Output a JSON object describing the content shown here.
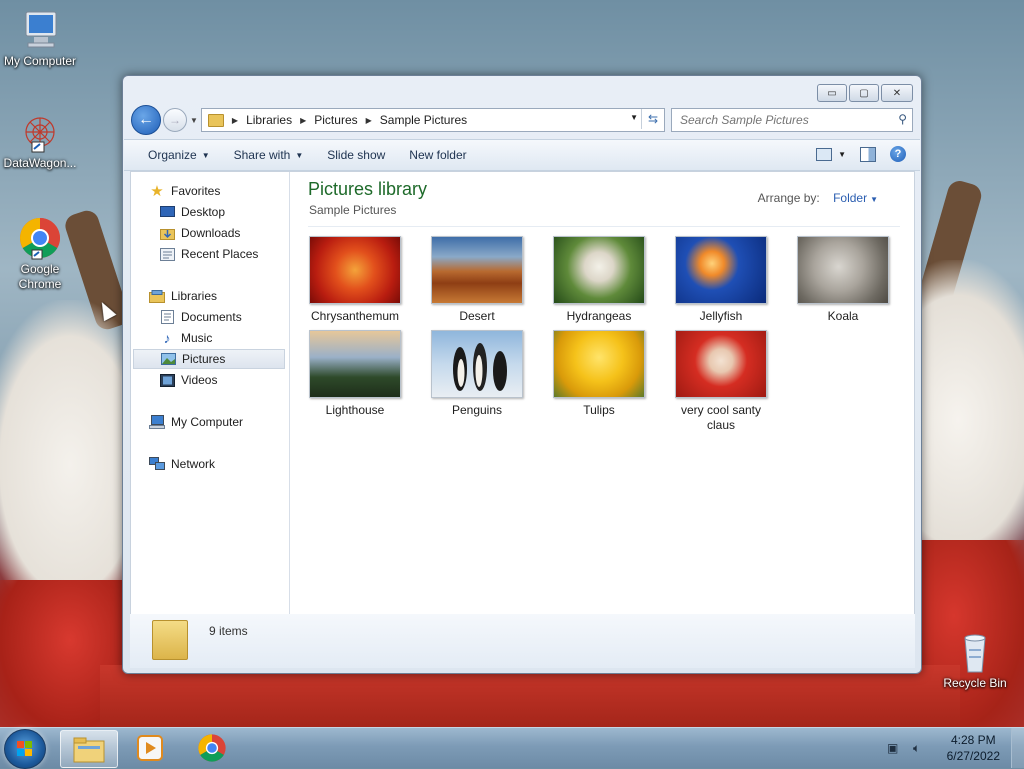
{
  "desktop": {
    "icons": [
      {
        "label": "My Computer"
      },
      {
        "label": "DataWagon..."
      },
      {
        "label": "Google Chrome"
      },
      {
        "label": "Recycle Bin"
      }
    ]
  },
  "window": {
    "controls": {
      "minimize": "▭",
      "maximize": "▢",
      "close": "✕"
    },
    "address": {
      "crumbs": [
        "Libraries",
        "Pictures",
        "Sample Pictures"
      ]
    },
    "search": {
      "placeholder": "Search Sample Pictures"
    },
    "toolbar": {
      "organize": "Organize",
      "share_with": "Share with",
      "slide_show": "Slide show",
      "new_folder": "New folder"
    },
    "nav": {
      "favorites": "Favorites",
      "desktop": "Desktop",
      "downloads": "Downloads",
      "recent_places": "Recent Places",
      "libraries": "Libraries",
      "documents": "Documents",
      "music": "Music",
      "pictures": "Pictures",
      "videos": "Videos",
      "my_computer": "My Computer",
      "network": "Network"
    },
    "content": {
      "title": "Pictures library",
      "subtitle": "Sample Pictures",
      "arrange_label": "Arrange by:",
      "arrange_value": "Folder",
      "items": [
        {
          "label": "Chrysanthemum"
        },
        {
          "label": "Desert"
        },
        {
          "label": "Hydrangeas"
        },
        {
          "label": "Jellyfish"
        },
        {
          "label": "Koala"
        },
        {
          "label": "Lighthouse"
        },
        {
          "label": "Penguins"
        },
        {
          "label": "Tulips"
        },
        {
          "label": "very cool santy claus"
        }
      ]
    },
    "status": {
      "count": "9 items"
    }
  },
  "taskbar": {
    "clock": {
      "time": "4:28 PM",
      "date": "6/27/2022"
    }
  }
}
